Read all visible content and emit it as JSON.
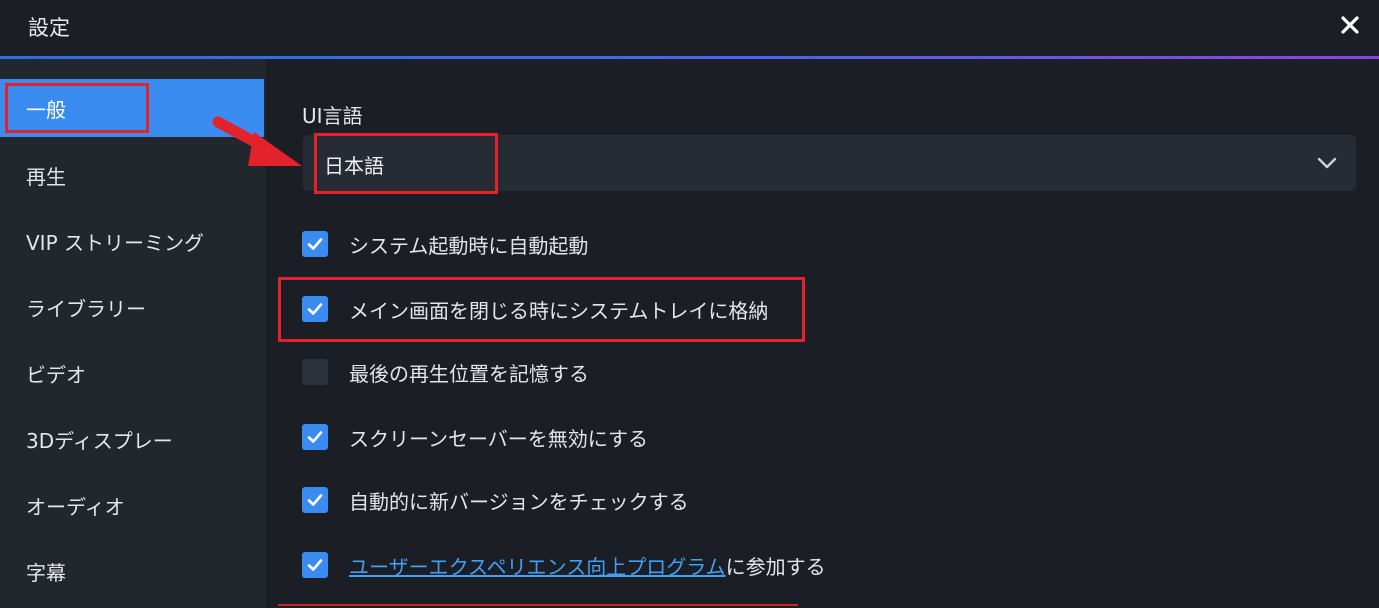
{
  "window": {
    "title": "設定"
  },
  "sidebar": {
    "items": [
      {
        "label": "一般",
        "active": true
      },
      {
        "label": "再生"
      },
      {
        "label": "VIP ストリーミング"
      },
      {
        "label": "ライブラリー"
      },
      {
        "label": "ビデオ"
      },
      {
        "label": "3Dディスプレー"
      },
      {
        "label": "オーディオ"
      },
      {
        "label": "字幕"
      }
    ]
  },
  "general": {
    "ui_language_label": "UI言語",
    "ui_language_value": "日本語",
    "options": [
      {
        "label": "システム起動時に自動起動",
        "checked": true
      },
      {
        "label": "メイン画面を閉じる時にシステムトレイに格納",
        "checked": true
      },
      {
        "label": "最後の再生位置を記憶する",
        "checked": false
      },
      {
        "label": "スクリーンセーバーを無効にする",
        "checked": true
      },
      {
        "label": "自動的に新バージョンをチェックする",
        "checked": true
      },
      {
        "link": "ユーザーエクスペリエンス向上プログラム",
        "label": "に参加する",
        "checked": true
      }
    ]
  },
  "colors": {
    "accent": "#3b8cf0",
    "highlight": "#e3232b",
    "background": "#1b1e24",
    "sidebar": "#22262d"
  }
}
